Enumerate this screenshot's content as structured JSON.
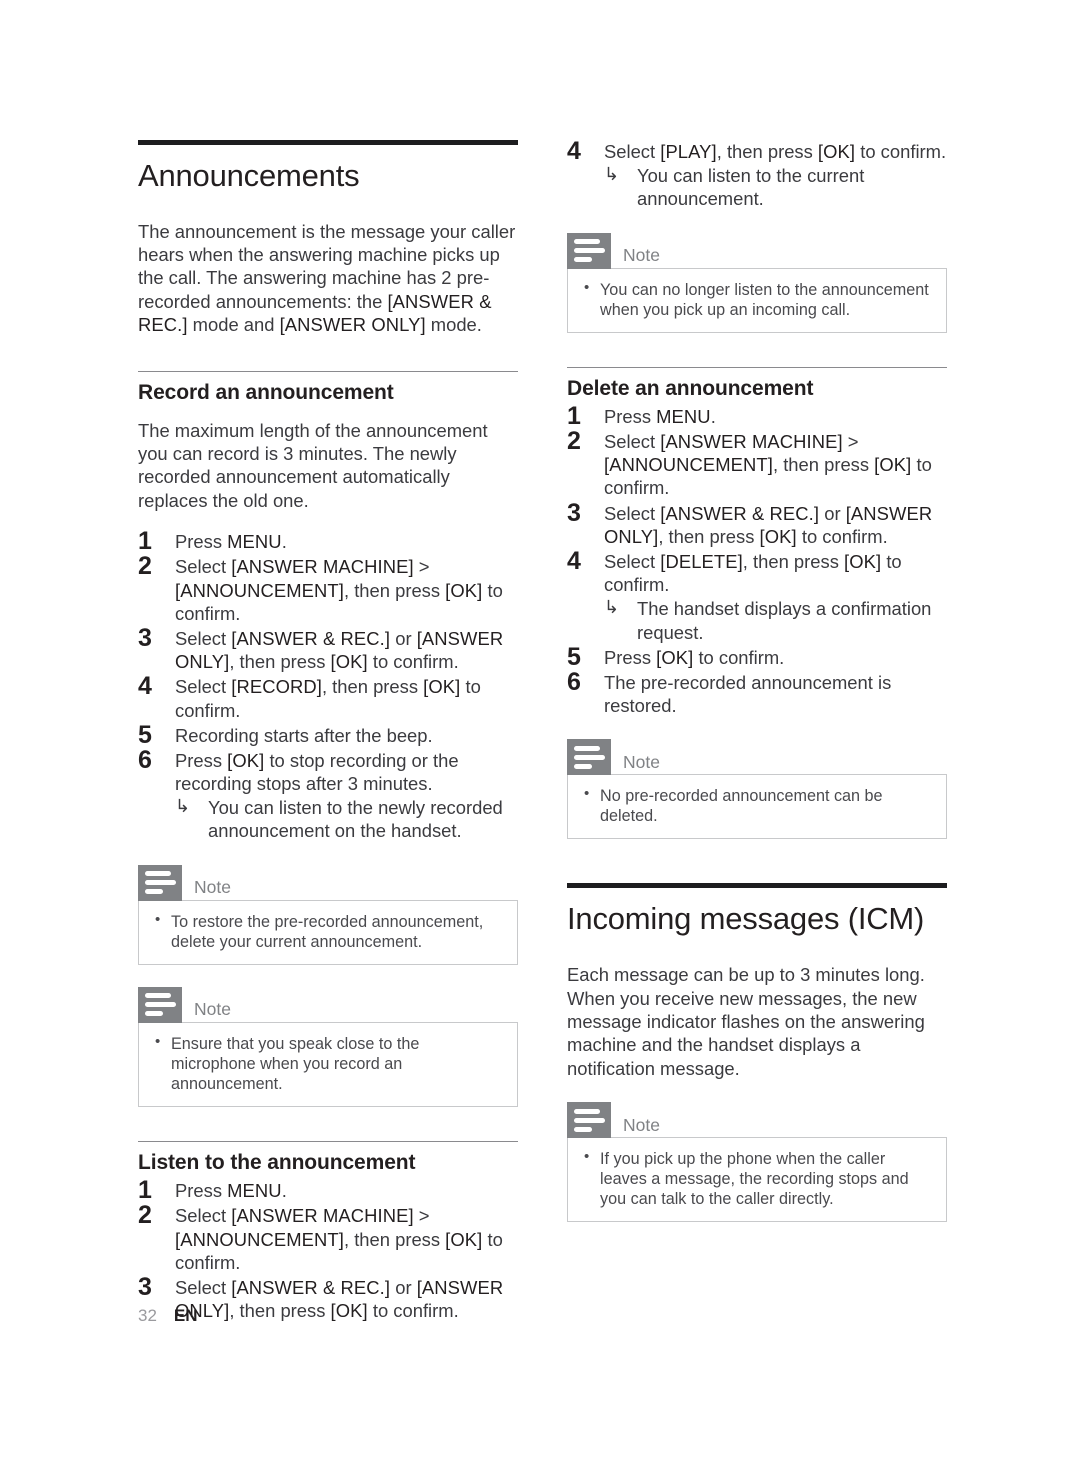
{
  "page": {
    "number": "32",
    "language": "EN"
  },
  "note_label": "Note",
  "arrow_glyph": "↳",
  "colors": {
    "text": "#3b3b3f",
    "heading": "#231f20",
    "note_icon_bg": "#808285",
    "note_border": "#c8c9cb",
    "rule_thick": "#1d1d1f",
    "rule_thin": "#8a8a8e"
  },
  "left_column": {
    "section_title": "Announcements",
    "intro": "The announcement is the message your caller hears when the answering machine picks up the call. The answering machine has 2 pre-recorded announcements: the [ANSWER & REC.] mode and [ANSWER ONLY] mode.",
    "record": {
      "heading": "Record an announcement",
      "intro": "The maximum length of the announcement you can record is 3 minutes. The newly recorded announcement automatically replaces the old one.",
      "steps": [
        {
          "num": "1",
          "text": "Press MENU."
        },
        {
          "num": "2",
          "text": "Select [ANSWER MACHINE] > [ANNOUNCEMENT], then press [OK] to confirm."
        },
        {
          "num": "3",
          "text": "Select [ANSWER & REC.] or [ANSWER ONLY], then press [OK] to confirm."
        },
        {
          "num": "4",
          "text": "Select [RECORD], then press [OK] to confirm."
        },
        {
          "num": "5",
          "text": "Recording starts after the beep."
        },
        {
          "num": "6",
          "text": "Press [OK] to stop recording or the recording stops after 3 minutes.",
          "result": "You can listen to the newly recorded announcement on the handset."
        }
      ],
      "note_1": "To restore the pre-recorded announcement, delete your current announcement.",
      "note_2": "Ensure that you speak close to the microphone when you record an announcement."
    },
    "listen": {
      "heading": "Listen to the announcement",
      "steps": [
        {
          "num": "1",
          "text": "Press MENU."
        },
        {
          "num": "2",
          "text": "Select [ANSWER MACHINE] > [ANNOUNCEMENT], then press [OK] to confirm."
        },
        {
          "num": "3",
          "text": "Select [ANSWER & REC.] or [ANSWER ONLY], then press [OK] to confirm."
        }
      ]
    }
  },
  "right_column": {
    "listen_continued": {
      "steps": [
        {
          "num": "4",
          "text": "Select [PLAY], then press [OK] to confirm.",
          "result": "You can listen to the current announcement."
        }
      ],
      "note_1": "You can no longer listen to the announcement when you pick up an incoming call."
    },
    "delete": {
      "heading": "Delete an announcement",
      "steps": [
        {
          "num": "1",
          "text": "Press MENU."
        },
        {
          "num": "2",
          "text": "Select [ANSWER MACHINE] > [ANNOUNCEMENT], then press [OK] to confirm."
        },
        {
          "num": "3",
          "text": "Select [ANSWER & REC.] or [ANSWER ONLY], then press [OK] to confirm."
        },
        {
          "num": "4",
          "text": "Select [DELETE], then press [OK] to confirm.",
          "result": "The handset displays a confirmation request."
        },
        {
          "num": "5",
          "text": "Press [OK] to confirm."
        },
        {
          "num": "6",
          "text": "The pre-recorded announcement is restored."
        }
      ],
      "note_1": "No pre-recorded announcement can be deleted."
    },
    "icm": {
      "section_title": "Incoming messages (ICM)",
      "intro": "Each message can be up to 3 minutes long. When you receive new messages, the new message indicator flashes on the answering machine and the handset displays a notification message.",
      "note_1": "If you pick up the phone when the caller leaves a message, the recording stops and you can talk to the caller directly."
    }
  }
}
